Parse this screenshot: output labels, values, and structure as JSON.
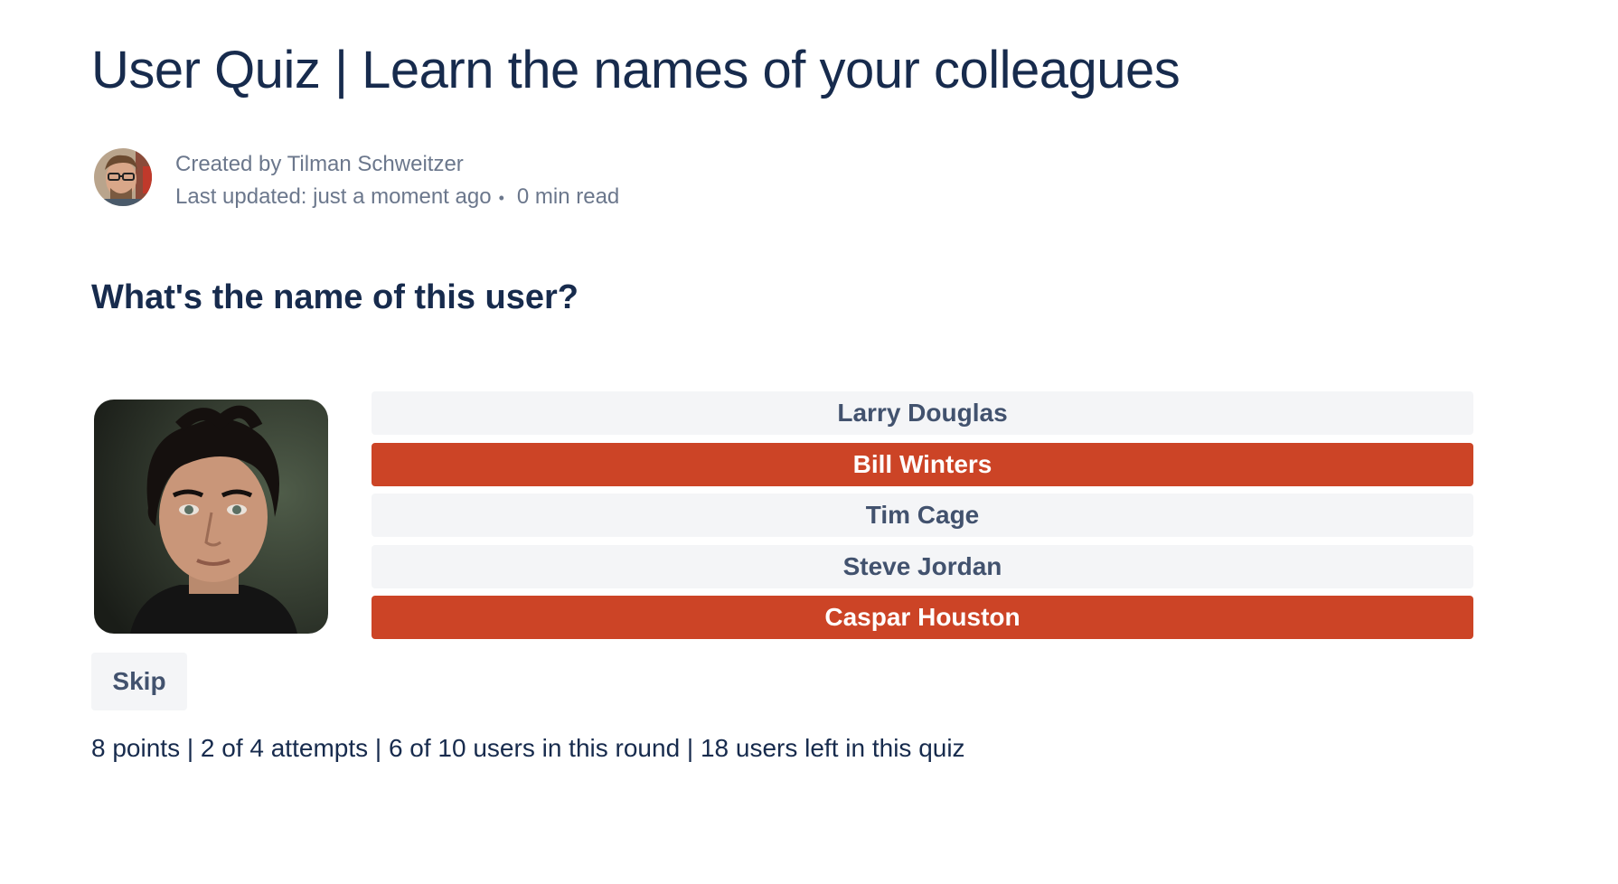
{
  "page": {
    "title": "User Quiz | Learn the names of your colleagues"
  },
  "byline": {
    "created_by": "Created by Tilman Schweitzer",
    "last_updated": "Last updated: just a moment ago",
    "separator": "•",
    "read_time": "0 min read",
    "avatar_icon": "author-avatar"
  },
  "quiz": {
    "question": "What's the name of this user?",
    "photo_icon": "user-photo",
    "options": [
      {
        "label": "Larry Douglas",
        "state": "neutral"
      },
      {
        "label": "Bill Winters",
        "state": "wrong"
      },
      {
        "label": "Tim Cage",
        "state": "neutral"
      },
      {
        "label": "Steve Jordan",
        "state": "neutral"
      },
      {
        "label": "Caspar Houston",
        "state": "wrong"
      }
    ],
    "skip_label": "Skip",
    "status": "8 points | 2 of 4 attempts | 6 of 10 users in this round | 18 users left in this quiz"
  },
  "colors": {
    "title": "#172B4D",
    "meta": "#6B778C",
    "option_bg": "#F4F5F7",
    "option_text": "#42526E",
    "wrong_bg": "#CC4426"
  }
}
